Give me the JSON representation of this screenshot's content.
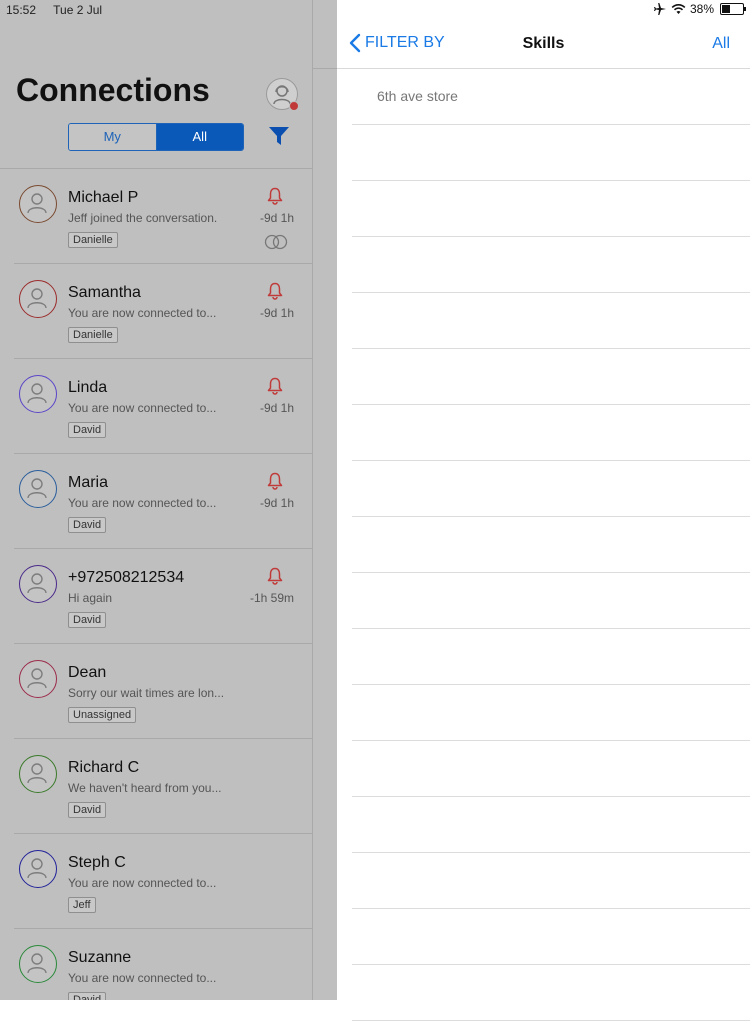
{
  "status_bar": {
    "time": "15:52",
    "date": "Tue 2 Jul",
    "battery": "38%",
    "battery_level": 0.38,
    "icons": [
      "airplane-icon",
      "wifi-icon",
      "battery-icon"
    ]
  },
  "connections": {
    "title": "Connections",
    "segments": {
      "my": "My",
      "all": "All",
      "selected": "All"
    },
    "items": [
      {
        "name": "Michael P",
        "message": "Jeff joined the conversation.",
        "tag": "Danielle",
        "time": "-9d 1h",
        "alert": true,
        "merged": true,
        "avatar_color": "#7a4a30"
      },
      {
        "name": "Samantha",
        "message": "You are now connected to...",
        "tag": "Danielle",
        "time": "-9d 1h",
        "alert": true,
        "merged": false,
        "avatar_color": "#9b2b2b"
      },
      {
        "name": "Linda",
        "message": "You are now connected to...",
        "tag": "David",
        "time": "-9d 1h",
        "alert": true,
        "merged": false,
        "avatar_color": "#5a46c8"
      },
      {
        "name": "Maria",
        "message": "You are now connected to...",
        "tag": "David",
        "time": "-9d 1h",
        "alert": true,
        "merged": false,
        "avatar_color": "#2a5e9c"
      },
      {
        "name": "+972508212534",
        "message": "Hi again",
        "tag": "David",
        "time": "-1h 59m",
        "alert": true,
        "merged": false,
        "avatar_color": "#4a2a8a"
      },
      {
        "name": "Dean",
        "message": "Sorry our wait times are lon...",
        "tag": "Unassigned",
        "time": "",
        "alert": false,
        "merged": false,
        "avatar_color": "#9b2b4a"
      },
      {
        "name": "Richard C",
        "message": "We haven't heard from you...",
        "tag": "David",
        "time": "",
        "alert": false,
        "merged": false,
        "avatar_color": "#3a7a2a"
      },
      {
        "name": "Steph C",
        "message": "You are now connected to...",
        "tag": "Jeff",
        "time": "",
        "alert": false,
        "merged": false,
        "avatar_color": "#22229a"
      },
      {
        "name": "Suzanne",
        "message": "You are now connected to...",
        "tag": "David",
        "time": "",
        "alert": false,
        "merged": false,
        "avatar_color": "#2a8a3a"
      }
    ]
  },
  "filter_panel": {
    "back_label": "FILTER BY",
    "title": "Skills",
    "all_label": "All",
    "skills": [
      "6th ave store",
      "",
      "",
      "",
      "",
      "",
      "",
      "",
      "",
      "",
      "",
      "",
      "",
      "",
      "",
      "",
      ""
    ]
  },
  "colors": {
    "accent": "#1a7ae6",
    "segment_selected": "#0a58b8",
    "alert": "#c03a3a",
    "dim_overlay": "#bfbfbf"
  }
}
